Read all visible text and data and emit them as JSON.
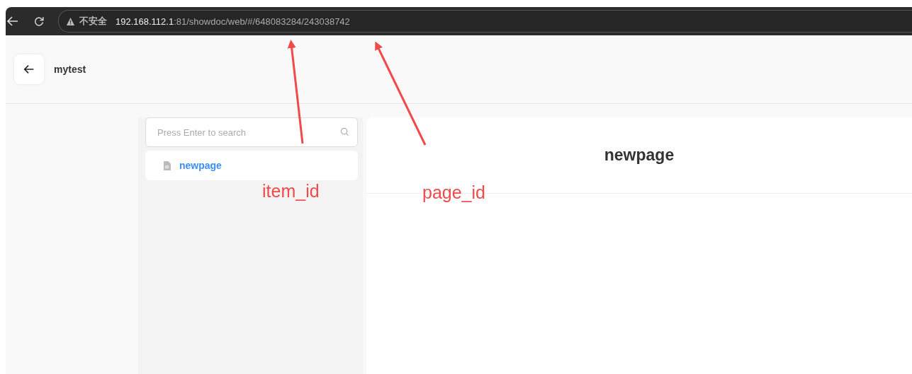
{
  "browser": {
    "security_label": "不安全",
    "url_host": "192.168.112.1",
    "url_path": ":81/showdoc/web/#/648083284/243038742"
  },
  "header": {
    "title": "mytest"
  },
  "sidebar": {
    "search": {
      "placeholder": "Press Enter to search"
    },
    "items": [
      {
        "label": "newpage",
        "selected": true
      }
    ]
  },
  "content": {
    "title": "newpage"
  },
  "annotations": [
    {
      "label": "item_id"
    },
    {
      "label": "page_id"
    }
  ]
}
